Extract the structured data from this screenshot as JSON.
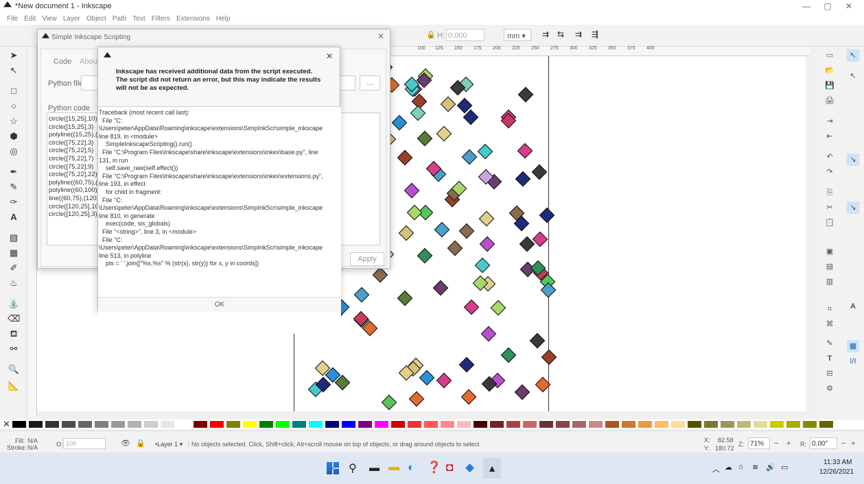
{
  "window": {
    "title": "*New document 1 - Inkscape"
  },
  "menu": [
    "File",
    "Edit",
    "View",
    "Layer",
    "Object",
    "Path",
    "Text",
    "Filters",
    "Extensions",
    "Help"
  ],
  "toolbar": {
    "h_label": "H:",
    "h_value": "0.000",
    "unit": "mm ▾"
  },
  "ruler": {
    "ticks": [
      "100",
      "125",
      "150",
      "175",
      "200",
      "225",
      "250",
      "275",
      "300",
      "325",
      "350",
      "375",
      "400"
    ]
  },
  "script_dialog": {
    "title": "Simple Inkscape Scripting",
    "tabs": [
      "Code",
      "About"
    ],
    "python_file_label": "Python file",
    "browse_label": "...",
    "python_code_label": "Python code",
    "code_lines": [
      "circle([15,25],10)",
      "circle([15,25],3)",
      "polyline((15,25),(",
      "circle([75,22],3)",
      "circle([75,22],5)",
      "circle([75,22],7)",
      "circle([75,22],9)",
      "circle([75,22],22)",
      "polyline((60,75),(",
      "polyline((60,100)",
      "line((60,75),(120,",
      "circle([120,25],10",
      "circle([120,25],3)"
    ],
    "apply_label": "Apply"
  },
  "message": {
    "heading": "Inkscape has received additional data from the script executed.\nThe script did not return an error, but this may indicate the results\nwill not be as expected.",
    "traceback": "Traceback (most recent call last):\n  File \"C:\n\\Users\\peter\\AppData\\Roaming\\inkscape\\extensions\\SimpInkScr\\simple_inkscape\nline 819, in <module>\n    SimpleInkscapeScripting().run()\n  File \"C:\\Program Files\\Inkscape\\share\\inkscape\\extensions\\inkex\\base.py\", line\n131, in run\n    self.save_raw(self.effect())\n  File \"C:\\Program Files\\Inkscape\\share\\inkscape\\extensions\\inkex\\extensions.py\",\nline 193, in effect\n    for child in fragment:\n  File \"C:\n\\Users\\peter\\AppData\\Roaming\\inkscape\\extensions\\SimpInkScr\\simple_inkscape\nline 810, in generate\n    exec(code, sis_globals)\n  File \"<string>\", line 3, in <module>\n  File \"C:\n\\Users\\peter\\AppData\\Roaming\\inkscape\\extensions\\SimpInkScr\\simple_inkscape\nline 513, in polyline\n    pts = ' '.join([\"%s,%s\" % (str(x), str(y)) for x, y in coords])",
    "ok_label": "OK"
  },
  "status": {
    "fill_label": "Fill:",
    "fill_value": "N/A",
    "stroke_label": "Stroke:",
    "stroke_value": "N/A",
    "opacity_label": "O:",
    "opacity_value": "100",
    "layer": "•Layer 1 ▾",
    "message": "No objects selected. Click, Shift+click, Alt+scroll mouse on top of objects, or drag around objects to select.",
    "x_label": "X:",
    "x_value": "82.58",
    "y_label": "Y:",
    "y_value": "180.72",
    "zoom_label": "Z:",
    "zoom_value": "71%",
    "rot_label": "R:",
    "rot_value": "0.00°"
  },
  "taskbar": {
    "time": "11:33 AM",
    "date": "12/26/2021"
  },
  "colors": {
    "accent": "#1f5fbf"
  }
}
